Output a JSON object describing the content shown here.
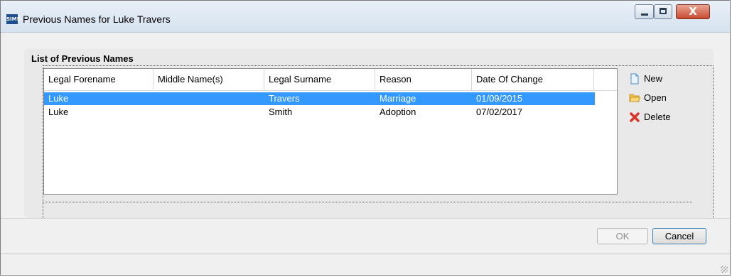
{
  "window": {
    "app_icon_text": "SIMS",
    "title": "Previous Names for Luke Travers",
    "close_glyph": "X"
  },
  "group": {
    "title": "List of Previous Names"
  },
  "grid": {
    "columns": [
      "Legal Forename",
      "Middle Name(s)",
      "Legal Surname",
      "Reason",
      "Date Of Change"
    ],
    "rows": [
      {
        "forename": "Luke",
        "middle": "",
        "surname": "Travers",
        "reason": "Marriage",
        "date": "01/09/2015",
        "selected": true
      },
      {
        "forename": "Luke",
        "middle": "",
        "surname": "Smith",
        "reason": "Adoption",
        "date": "07/02/2017",
        "selected": false
      }
    ]
  },
  "actions": {
    "new_label": "New",
    "open_label": "Open",
    "delete_label": "Delete"
  },
  "buttons": {
    "ok_label": "OK",
    "cancel_label": "Cancel"
  },
  "colors": {
    "selection": "#3399ff",
    "close_button": "#c94b33"
  }
}
